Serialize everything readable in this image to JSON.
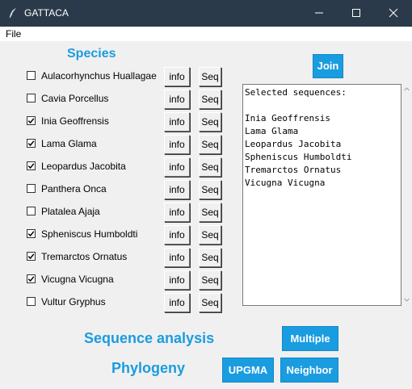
{
  "window": {
    "title": "GATTACA",
    "icon": "feather-icon"
  },
  "menu": {
    "file_label": "File"
  },
  "species_heading": "Species",
  "species": [
    {
      "name": "Aulacorhynchus Huallagae",
      "checked": false
    },
    {
      "name": "Cavia Porcellus",
      "checked": false
    },
    {
      "name": "Inia Geoffrensis",
      "checked": true
    },
    {
      "name": "Lama Glama",
      "checked": true
    },
    {
      "name": "Leopardus Jacobita",
      "checked": true
    },
    {
      "name": "Panthera Onca",
      "checked": false
    },
    {
      "name": "Platalea Ajaja",
      "checked": false
    },
    {
      "name": "Spheniscus Humboldti",
      "checked": true
    },
    {
      "name": "Tremarctos Ornatus",
      "checked": true
    },
    {
      "name": "Vicugna Vicugna",
      "checked": true
    },
    {
      "name": "Vultur Gryphus",
      "checked": false
    }
  ],
  "info_label": "info",
  "seq_label": "Seq",
  "join_label": "Join",
  "selected_text": "Selected sequences:\n\nInia Geoffrensis\nLama Glama\nLeopardus Jacobita\nSpheniscus Humboldti\nTremarctos Ornatus\nVicugna Vicugna",
  "sequence_analysis_heading": "Sequence analysis",
  "multiple_label": "Multiple",
  "phylogeny_heading": "Phylogeny",
  "upgma_label": "UPGMA",
  "neighbor_label": "Neighbor",
  "colors": {
    "accent": "#1a9ce0",
    "titlebar": "#2b3a4a",
    "background": "#f0f0f0"
  }
}
